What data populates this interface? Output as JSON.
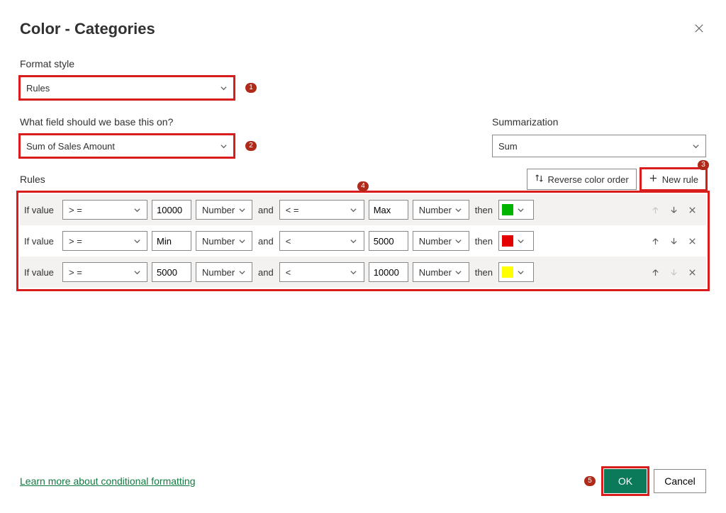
{
  "title": "Color - Categories",
  "format_style": {
    "label": "Format style",
    "value": "Rules"
  },
  "base_field": {
    "label": "What field should we base this on?",
    "value": "Sum of Sales Amount"
  },
  "summarization": {
    "label": "Summarization",
    "value": "Sum"
  },
  "rules_header": {
    "label": "Rules",
    "reverse_btn": "Reverse color order",
    "new_rule_btn": "New rule"
  },
  "row_labels": {
    "if_value": "If value",
    "and": "and",
    "then": "then"
  },
  "rules": [
    {
      "op1": "> =",
      "val1": "10000",
      "type1": "Number",
      "op2": "< =",
      "val2": "Max",
      "type2": "Number",
      "color": "#00b400"
    },
    {
      "op1": "> =",
      "val1": "Min",
      "type1": "Number",
      "op2": "<",
      "val2": "5000",
      "type2": "Number",
      "color": "#e50000"
    },
    {
      "op1": "> =",
      "val1": "5000",
      "type1": "Number",
      "op2": "<",
      "val2": "10000",
      "type2": "Number",
      "color": "#ffff00"
    }
  ],
  "badges": {
    "b1": "1",
    "b2": "2",
    "b3": "3",
    "b4": "4",
    "b5": "5"
  },
  "footer": {
    "link": "Learn more about conditional formatting",
    "ok": "OK",
    "cancel": "Cancel"
  }
}
